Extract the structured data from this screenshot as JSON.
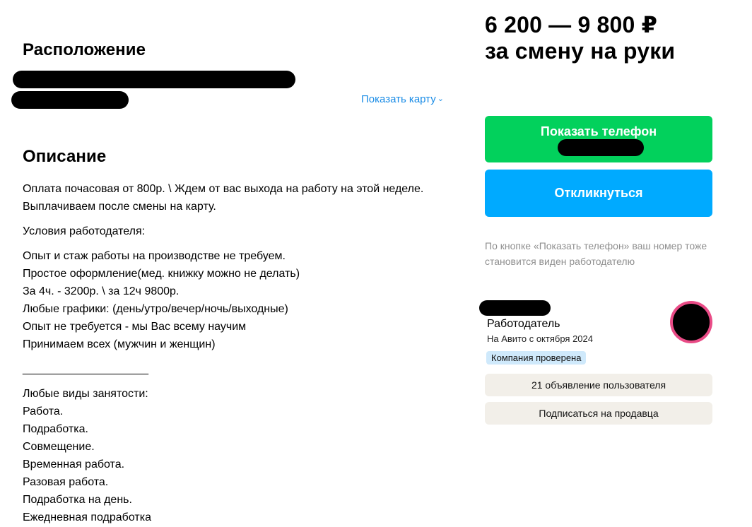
{
  "location": {
    "heading": "Расположение",
    "show_map_label": "Показать карту"
  },
  "description": {
    "heading": "Описание",
    "paragraphs": [
      [
        "Оплата почасовая от 800р. \\ Ждем от вас выхода на работу на этой неделе.",
        "Выплачиваем после смены на карту."
      ],
      [
        "Условия работодателя:"
      ],
      [
        "Опыт и стаж работы на производстве не требуем.",
        "Простое оформление(мед. книжку можно не делать)",
        "За 4ч. - 3200р. \\ за 12ч 9800р.",
        "Любые графики: (день/утро/вечер/ночь/выходные)",
        "Опыт не требуется - мы Вас всему научим",
        "Принимаем всех (мужчин и женщин)"
      ],
      [
        "____________________"
      ],
      [
        "Любые виды занятости:",
        "Работа.",
        "Подработка.",
        "Совмещение.",
        "Временная работа.",
        "Разовая работа.",
        "Подработка на день.",
        "Ежедневная подработка"
      ]
    ]
  },
  "price": {
    "range": "6 200 — 9 800 ₽",
    "period": "за смену на руки"
  },
  "actions": {
    "show_phone": "Показать телефон",
    "respond": "Откликнуться",
    "phone_note": "По кнопке «Показать телефон» ваш номер тоже становится виден работодателю"
  },
  "seller": {
    "role": "Работодатель",
    "since": "На Авито с октября 2024",
    "badge": "Компания проверена",
    "listings": "21 объявление пользователя",
    "subscribe": "Подписаться на продавца"
  },
  "colors": {
    "green": "#02d15c",
    "blue": "#00aaff",
    "link": "#1a8ce6",
    "avatar_ring": "#e94b86"
  }
}
